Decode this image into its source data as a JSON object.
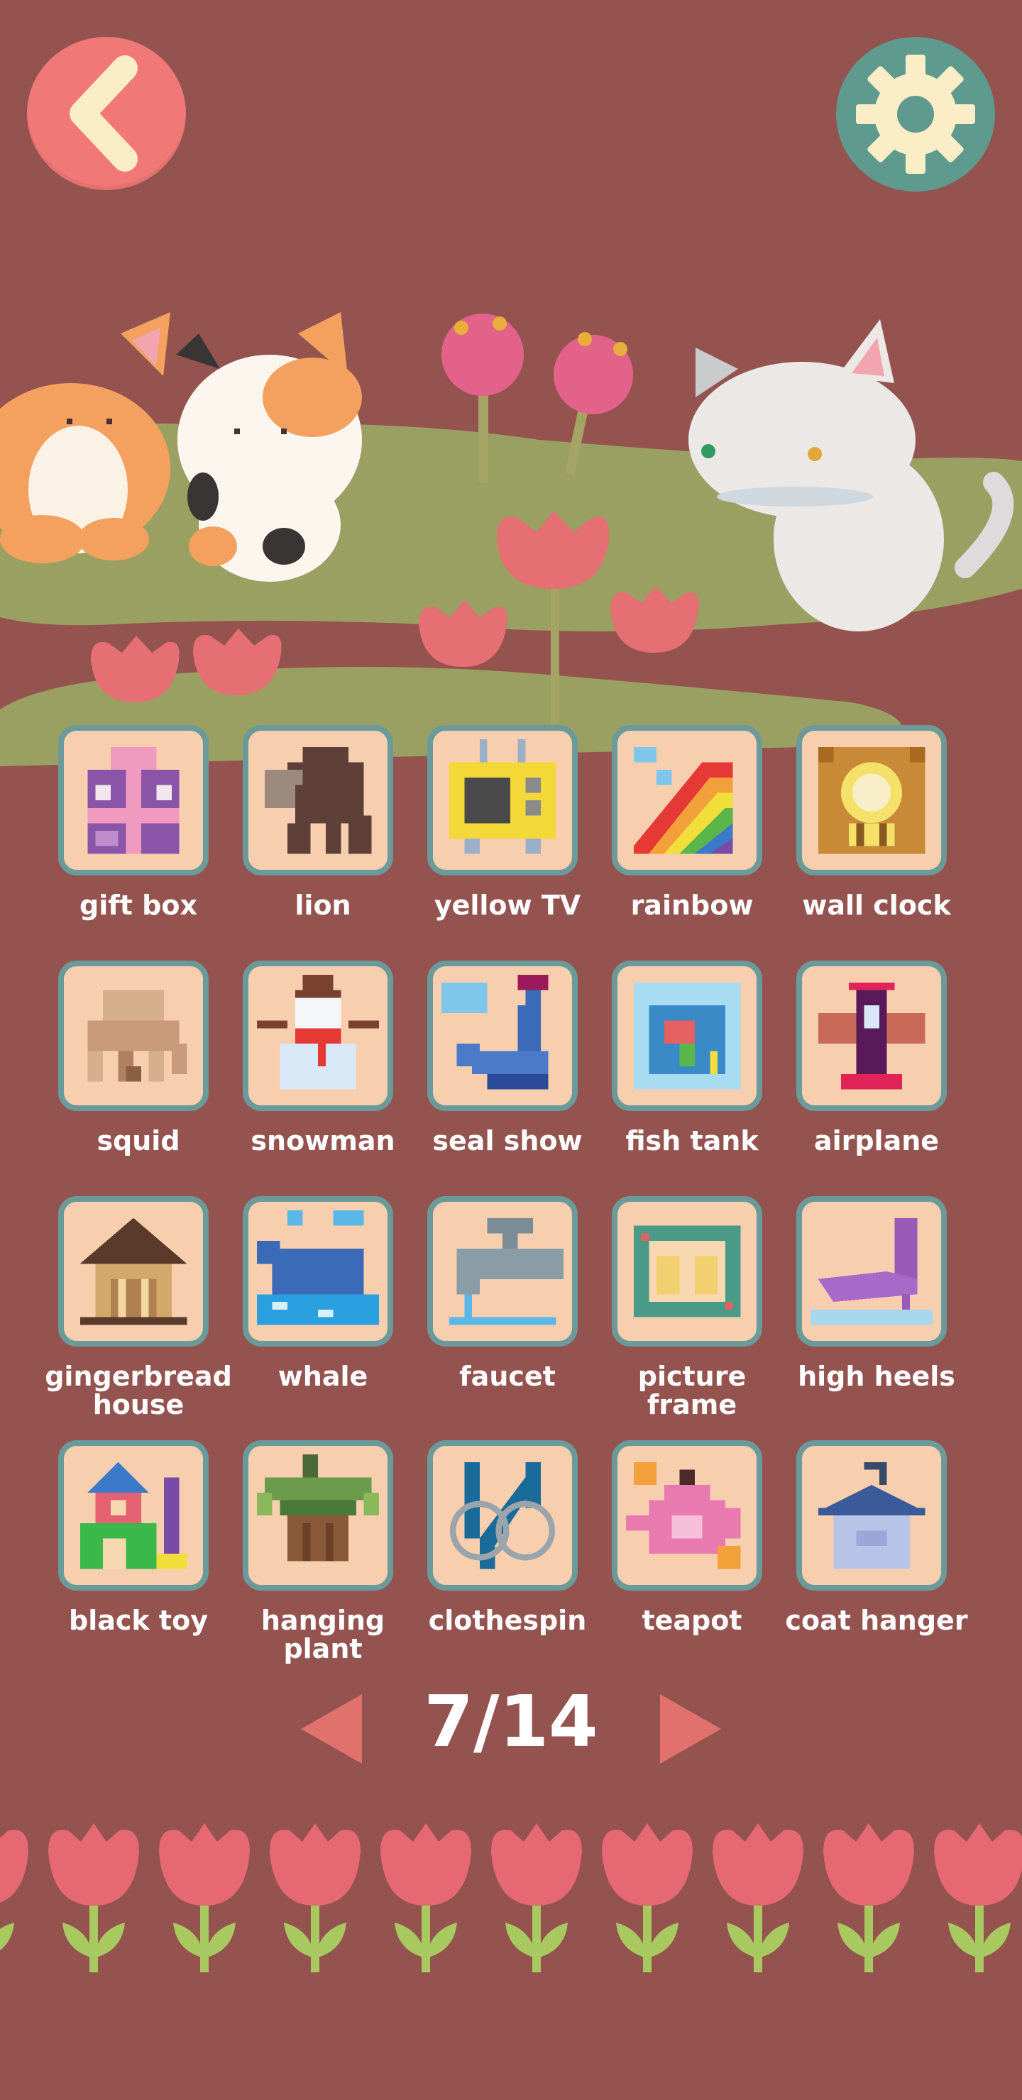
{
  "header": {
    "back_icon": "chevron-left-icon",
    "settings_icon": "gear-icon"
  },
  "colors": {
    "background": "#955350",
    "back_button": "#f07876",
    "settings_button": "#5e9a8e",
    "tile_fill": "#f7cfaf",
    "tile_border": "#6a9a99",
    "pager_arrow": "#e0716c"
  },
  "puzzles": [
    {
      "label": "gift box"
    },
    {
      "label": "lion"
    },
    {
      "label": "yellow TV"
    },
    {
      "label": "rainbow"
    },
    {
      "label": "wall clock"
    },
    {
      "label": "squid"
    },
    {
      "label": "snowman"
    },
    {
      "label": "seal show"
    },
    {
      "label": "fish tank"
    },
    {
      "label": "airplane"
    },
    {
      "label": "gingerbread house"
    },
    {
      "label": "whale"
    },
    {
      "label": "faucet"
    },
    {
      "label": "picture frame"
    },
    {
      "label": "high heels"
    },
    {
      "label": "black toy"
    },
    {
      "label": "hanging plant"
    },
    {
      "label": "clothespin"
    },
    {
      "label": "teapot"
    },
    {
      "label": "coat hanger"
    }
  ],
  "pager": {
    "text": "7/14",
    "current": 7,
    "total": 14
  }
}
